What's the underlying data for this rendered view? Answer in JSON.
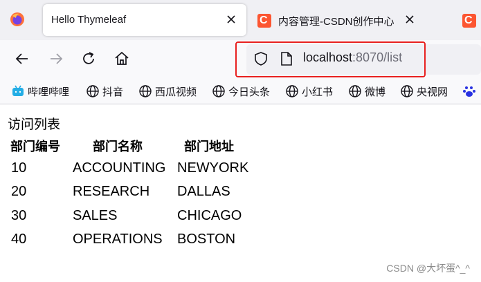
{
  "browser": {
    "tabs": [
      {
        "title": "Hello Thymeleaf",
        "active": true
      },
      {
        "title": "内容管理-CSDN创作中心",
        "active": false,
        "favicon": "csdn-icon"
      }
    ],
    "url": {
      "host": "localhost",
      "rest": ":8070/list"
    },
    "bookmarks": [
      {
        "label": "哔哩哔哩",
        "icon": "bilibili-icon"
      },
      {
        "label": "抖音",
        "icon": "globe-icon"
      },
      {
        "label": "西瓜视频",
        "icon": "globe-icon"
      },
      {
        "label": "今日头条",
        "icon": "globe-icon"
      },
      {
        "label": "小红书",
        "icon": "globe-icon"
      },
      {
        "label": "微博",
        "icon": "globe-icon"
      },
      {
        "label": "央视网",
        "icon": "globe-icon"
      }
    ],
    "colors": {
      "highlight": "#e8201f",
      "csdn": "#fc5531",
      "bilibili": "#23ade5",
      "baidu": "#2932e1"
    }
  },
  "page": {
    "heading": "访问列表",
    "table": {
      "headers": [
        "部门编号",
        "部门名称",
        "部门地址"
      ],
      "rows": [
        [
          "10",
          "ACCOUNTING",
          "NEWYORK"
        ],
        [
          "20",
          "RESEARCH",
          "DALLAS"
        ],
        [
          "30",
          "SALES",
          "CHICAGO"
        ],
        [
          "40",
          "OPERATIONS",
          "BOSTON"
        ]
      ]
    },
    "watermark": "CSDN @大坏蛋^_^"
  }
}
